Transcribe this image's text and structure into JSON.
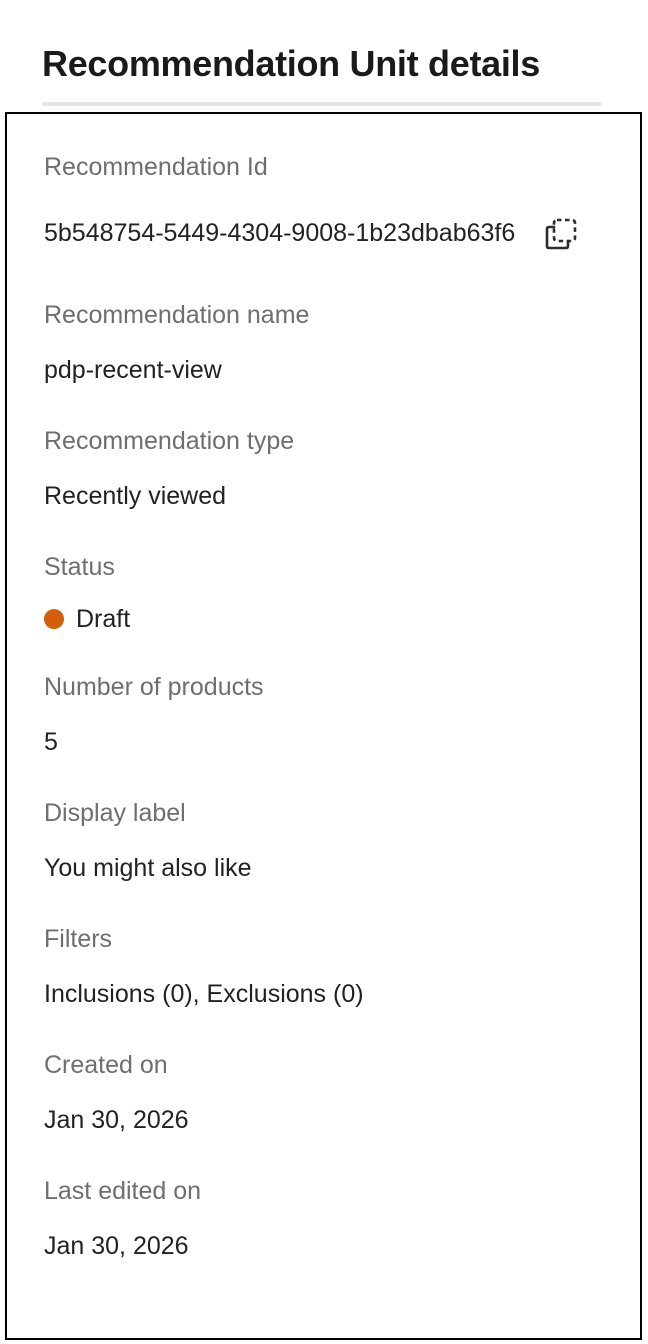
{
  "header": {
    "title": "Recommendation Unit details"
  },
  "details": {
    "id_label": "Recommendation Id",
    "id_value": "5b548754-5449-4304-9008-1b23dbab63f6",
    "name_label": "Recommendation name",
    "name_value": "pdp-recent-view",
    "type_label": "Recommendation type",
    "type_value": "Recently viewed",
    "status_label": "Status",
    "status_value": "Draft",
    "status_color": "#d35f0c",
    "products_label": "Number of products",
    "products_value": "5",
    "display_label_label": "Display label",
    "display_label_value": "You might also like",
    "filters_label": "Filters",
    "filters_value": "Inclusions (0), Exclusions (0)",
    "created_label": "Created on",
    "created_value": "Jan 30, 2026",
    "edited_label": "Last edited on",
    "edited_value": "Jan 30, 2026"
  },
  "icons": {
    "copy": "copy-icon"
  }
}
